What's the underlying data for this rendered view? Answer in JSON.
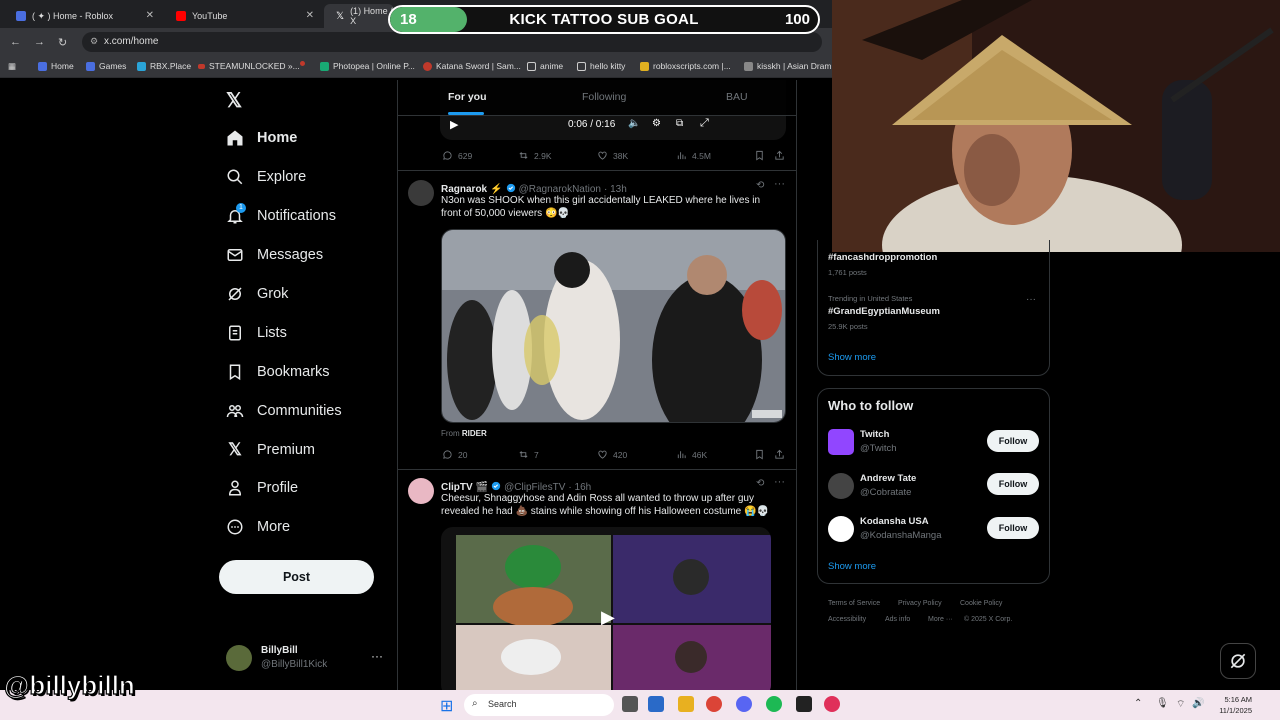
{
  "browser": {
    "tabs": [
      {
        "label": "( ✦ ) Home - Roblox",
        "color": "#4a6ee0"
      },
      {
        "label": "YouTube",
        "color": "#ff0000"
      },
      {
        "label": "(1) Home / X",
        "color": "#ffffff"
      },
      {
        "label": "",
        "color": "#c0392b"
      }
    ],
    "url": "x.com/home",
    "bookmarks": [
      {
        "label": "Home",
        "color": "#4a6ee0"
      },
      {
        "label": "Games",
        "color": "#4a6ee0"
      },
      {
        "label": "RBX.Place",
        "color": "#2aa4d8"
      },
      {
        "label": "STEAMUNLOCKED »...",
        "color": "#c0392b"
      },
      {
        "label": "",
        "color": "#c0392b"
      },
      {
        "label": "Photopea | Online P...",
        "color": "#19a974"
      },
      {
        "label": "Katana Sword | Sam...",
        "color": "#c0392b"
      },
      {
        "label": "anime",
        "color": "folder"
      },
      {
        "label": "hello kitty",
        "color": "folder"
      },
      {
        "label": "robloxscripts.com |...",
        "color": "#e0b020"
      },
      {
        "label": "kisskh | Asian Dram...",
        "color": "#888888"
      }
    ]
  },
  "goal": {
    "start": "18",
    "title": "KICK TATTOO SUB GOAL",
    "end": "100",
    "progress": 0.18
  },
  "sidebar": {
    "items": [
      {
        "label": "Home",
        "icon": "home-icon"
      },
      {
        "label": "Explore",
        "icon": "search-icon"
      },
      {
        "label": "Notifications",
        "icon": "bell-icon",
        "badge": "1"
      },
      {
        "label": "Messages",
        "icon": "mail-icon"
      },
      {
        "label": "Grok",
        "icon": "grok-icon"
      },
      {
        "label": "Lists",
        "icon": "list-icon"
      },
      {
        "label": "Bookmarks",
        "icon": "bookmark-icon"
      },
      {
        "label": "Communities",
        "icon": "people-icon"
      },
      {
        "label": "Premium",
        "icon": "x-logo-icon"
      },
      {
        "label": "Profile",
        "icon": "person-icon"
      },
      {
        "label": "More",
        "icon": "more-circle-icon"
      }
    ],
    "post_label": "Post",
    "account": {
      "name": "BillyBill",
      "handle": "@BillyBill1Kick"
    }
  },
  "feed": {
    "tabs": [
      "For you",
      "Following",
      "BAU"
    ],
    "video_time": "0:06 / 0:16",
    "post0_stats": {
      "replies": "629",
      "reposts": "2.9K",
      "likes": "38K",
      "views": "4.5M"
    },
    "post1": {
      "name": "Ragnarok",
      "emoji": "⚡",
      "handle": "@RagnarokNation",
      "time": "· 13h",
      "text": "N3on was SHOOK when this girl accidentally LEAKED where he lives in front of 50,000 viewers 😳💀",
      "from_prefix": "From",
      "from_name": "RIDER",
      "stats": {
        "replies": "20",
        "reposts": "7",
        "likes": "420",
        "views": "46K"
      }
    },
    "post2": {
      "name": "ClipTV",
      "emoji": "🎬",
      "handle": "@ClipFilesTV",
      "time": "· 16h",
      "text": "Cheesur, Shnaggyhose and Adin Ross all  wanted to throw up after guy revealed he had 💩 stains while showing off his Halloween costume 😭💀"
    }
  },
  "trends": [
    {
      "sub": "",
      "tag": "#fancashdroppromotion",
      "count": "1,761 posts"
    },
    {
      "sub": "Trending in United States",
      "tag": "#GrandEgyptianMuseum",
      "count": "25.9K posts"
    }
  ],
  "show_more": "Show more",
  "who_to_follow": {
    "title": "Who to follow",
    "accounts": [
      {
        "name": "Twitch",
        "handle": "@Twitch",
        "color": "#9146ff"
      },
      {
        "name": "Andrew Tate",
        "handle": "@Cobratate",
        "color": "#444444"
      },
      {
        "name": "Kodansha USA",
        "handle": "@KodanshaManga",
        "color": "#ffffff"
      }
    ],
    "follow_label": "Follow",
    "show_more": "Show more"
  },
  "footer": {
    "row1": [
      "Terms of Service",
      "Privacy Policy",
      "Cookie Policy"
    ],
    "row2": [
      "Accessibility",
      "Ads info",
      "More ···",
      "© 2025 X Corp."
    ]
  },
  "taskbar": {
    "search_placeholder": "Search",
    "time": "5:16 AM",
    "date": "11/1/2025"
  },
  "watermark": "@billybilln"
}
